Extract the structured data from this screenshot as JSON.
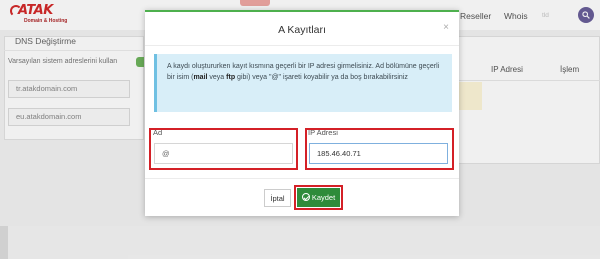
{
  "background": {
    "logo": {
      "brand": "ATAK",
      "tagline": "Domain & Hosting"
    },
    "nav": {
      "reseller": "Reseller",
      "whois": "Whois",
      "tld_placeholder": "tld"
    },
    "dns_section": {
      "title": "DNS Değiştirme",
      "description": "Varsayılan sistem adreslerini kullan",
      "nameservers": [
        "tr.atakdomain.com",
        "eu.atakdomain.com"
      ]
    },
    "records_table": {
      "columns": [
        "IP Adresi",
        "İşlem"
      ]
    }
  },
  "modal": {
    "title": "A Kayıtları",
    "close_icon": "×",
    "alert": {
      "text_before": "A kaydı oluştururken kayıt kısmına geçerli bir IP adresi girmelisiniz. Ad bölümüne geçerli bir isim (",
      "bold1": "mail",
      "text_mid1": " veya ",
      "bold2": "ftp",
      "text_after": " gibi) veya \"@\" işareti koyabilir ya da boş bırakabilirsiniz"
    },
    "name_label": "Ad",
    "name_value": "@",
    "ip_label": "IP Adresi",
    "ip_value": "185.46.40.71",
    "cancel_label": "İptal",
    "save_label": "Kaydet"
  },
  "colors": {
    "accent_green": "#2e8b3a",
    "highlight_red": "#d42027",
    "alert_bg": "#d8eef8",
    "brand_red": "#d42a2a"
  }
}
